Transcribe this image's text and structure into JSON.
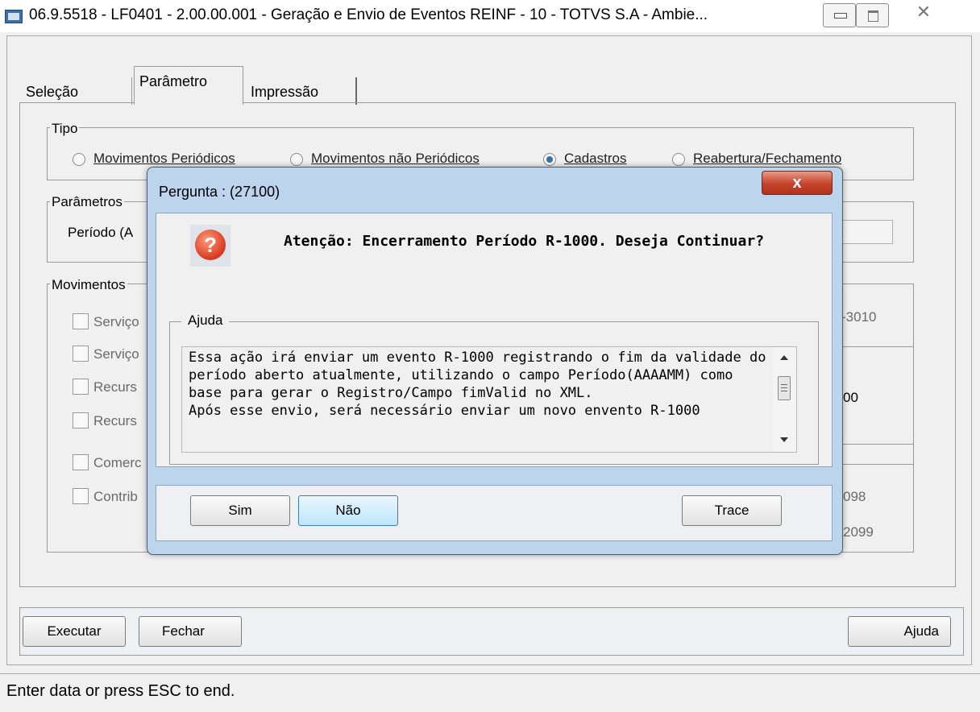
{
  "window": {
    "title": "06.9.5518 - LF0401 - 2.00.00.001 - Geração e Envio de Eventos REINF - 10 - TOTVS S.A - Ambie...",
    "close_glyph": "✕"
  },
  "tabs": [
    {
      "label": "Seleção"
    },
    {
      "label": "Parâmetro"
    },
    {
      "label": "Impressão"
    }
  ],
  "tipo": {
    "label": "Tipo",
    "options": [
      {
        "label": "Movimentos Periódicos",
        "selected": false
      },
      {
        "label": "Movimentos não Periódicos",
        "selected": false
      },
      {
        "label": "Cadastros",
        "selected": true
      },
      {
        "label": "Reabertura/Fechamento",
        "selected": false
      }
    ]
  },
  "parametros": {
    "label": "Parâmetros",
    "periodo_label": "Período (A"
  },
  "movimentos": {
    "label": "Movimentos",
    "items": [
      "Serviço",
      "Serviço",
      "Recurs",
      "Recurs",
      "Comerc",
      "Contrib"
    ],
    "right_texts": [
      "-3010",
      "00",
      "098",
      "2099"
    ]
  },
  "buttons": {
    "executar": "Executar",
    "fechar": "Fechar",
    "ajuda": "Ajuda"
  },
  "status": "Enter data or press ESC to end.",
  "dialog": {
    "title": "Pergunta : (27100)",
    "close": "x",
    "icon": "?",
    "message": "Atenção: Encerramento Período R-1000. Deseja Continuar?",
    "help_label": "Ajuda",
    "help_text": "Essa ação irá enviar um evento R-1000 registrando o fim da validade do período aberto atualmente, utilizando o campo Período(AAAAMM) como base para gerar o Registro/Campo fimValid no XML.\nApós esse envio, será necessário enviar um novo envento R-1000",
    "buttons": {
      "sim": "Sim",
      "nao": "Não",
      "trace": "Trace"
    }
  }
}
